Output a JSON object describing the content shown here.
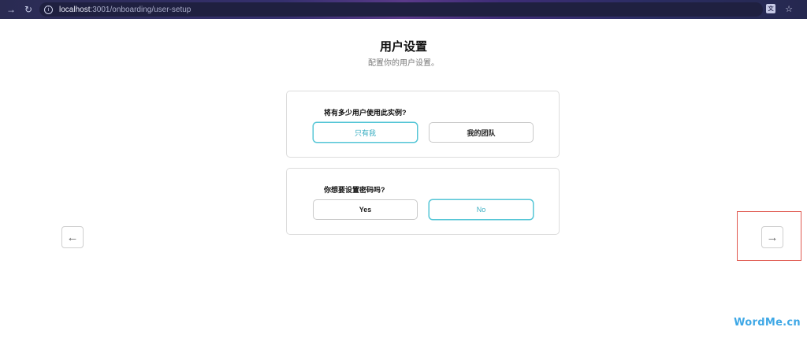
{
  "browser": {
    "url_host": "localhost",
    "url_rest": ":3001/onboarding/user-setup"
  },
  "page": {
    "title": "用户设置",
    "subtitle": "配置你的用户设置。"
  },
  "questions": [
    {
      "label": "将有多少用户使用此实例?",
      "options": [
        {
          "label": "只有我",
          "selected": true
        },
        {
          "label": "我的团队",
          "selected": false
        }
      ]
    },
    {
      "label": "你想要设置密码吗?",
      "options": [
        {
          "label": "Yes",
          "selected": false
        },
        {
          "label": "No",
          "selected": true
        }
      ]
    }
  ],
  "icons": {
    "back": "arrow-left-icon",
    "next": "arrow-right-icon"
  },
  "colors": {
    "accent": "#55c6d6",
    "highlight": "#e0584f",
    "watermark": "#3fa8e6"
  },
  "watermark": "WordMe.cn"
}
